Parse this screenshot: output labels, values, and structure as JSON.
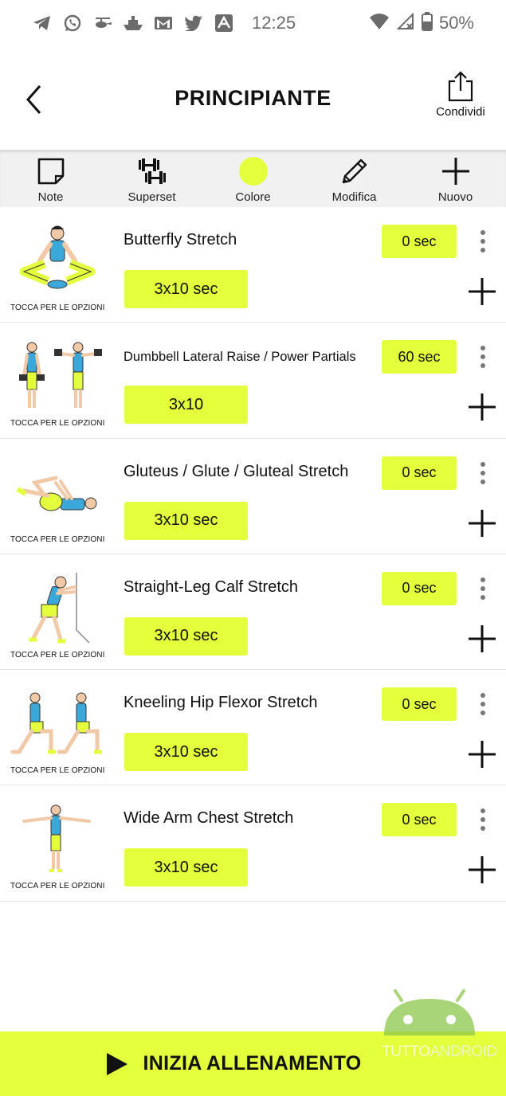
{
  "status_bar": {
    "time": "12:25",
    "battery": "50%",
    "notification_icons": [
      "telegram-icon",
      "whatsapp-icon",
      "helicopter-icon",
      "ship-icon",
      "gmail-icon",
      "twitter-icon",
      "a-app-icon"
    ]
  },
  "header": {
    "title": "PRINCIPIANTE",
    "share_label": "Condividi"
  },
  "toolbar": {
    "note_label": "Note",
    "superset_label": "Superset",
    "color_label": "Colore",
    "edit_label": "Modifica",
    "new_label": "Nuovo",
    "selected_color": "#e4ff3c"
  },
  "exercises": [
    {
      "name": "Butterfly Stretch",
      "sets": "3x10 sec",
      "rest": "0 sec",
      "caption": "TOCCA PER LE OPZIONI"
    },
    {
      "name": "Dumbbell Lateral Raise / Power Partials",
      "sets": "3x10",
      "rest": "60 sec",
      "caption": "TOCCA PER LE OPZIONI"
    },
    {
      "name": "Gluteus / Glute / Gluteal Stretch",
      "sets": "3x10 sec",
      "rest": "0 sec",
      "caption": "TOCCA PER LE OPZIONI"
    },
    {
      "name": "Straight-Leg Calf Stretch",
      "sets": "3x10 sec",
      "rest": "0 sec",
      "caption": "TOCCA PER LE OPZIONI"
    },
    {
      "name": "Kneeling Hip Flexor Stretch",
      "sets": "3x10 sec",
      "rest": "0 sec",
      "caption": "TOCCA PER LE OPZIONI"
    },
    {
      "name": "Wide Arm Chest Stretch",
      "sets": "3x10 sec",
      "rest": "0 sec",
      "caption": "TOCCA PER LE OPZIONI"
    }
  ],
  "cta": {
    "label": "INIZIA ALLENAMENTO"
  },
  "watermark": {
    "part1": "TUTTO",
    "part2": "ANDROID"
  },
  "colors": {
    "accent": "#e4ff3c",
    "toolbar_bg": "#f1f1f1"
  }
}
